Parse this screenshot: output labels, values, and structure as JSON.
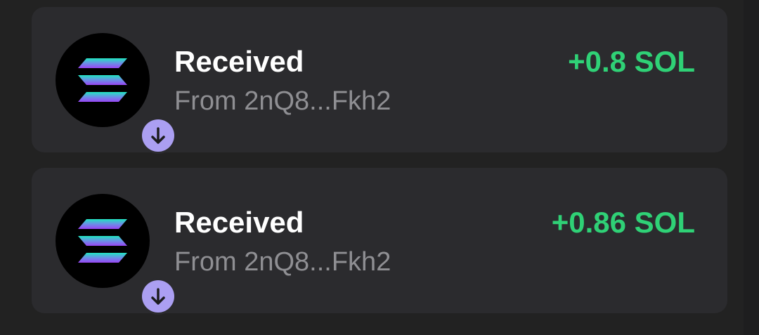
{
  "colors": {
    "background": "#222222",
    "card": "#2b2b2e",
    "title": "#ffffff",
    "subtitle": "#8f8f93",
    "amount_positive": "#2fd176",
    "badge": "#ab9ff2"
  },
  "transactions": [
    {
      "icon": "solana-logo-icon",
      "badge_icon": "arrow-down-icon",
      "title": "Received",
      "subtitle": "From 2nQ8...Fkh2",
      "amount": "+0.8 SOL"
    },
    {
      "icon": "solana-logo-icon",
      "badge_icon": "arrow-down-icon",
      "title": "Received",
      "subtitle": "From 2nQ8...Fkh2",
      "amount": "+0.86 SOL"
    }
  ]
}
